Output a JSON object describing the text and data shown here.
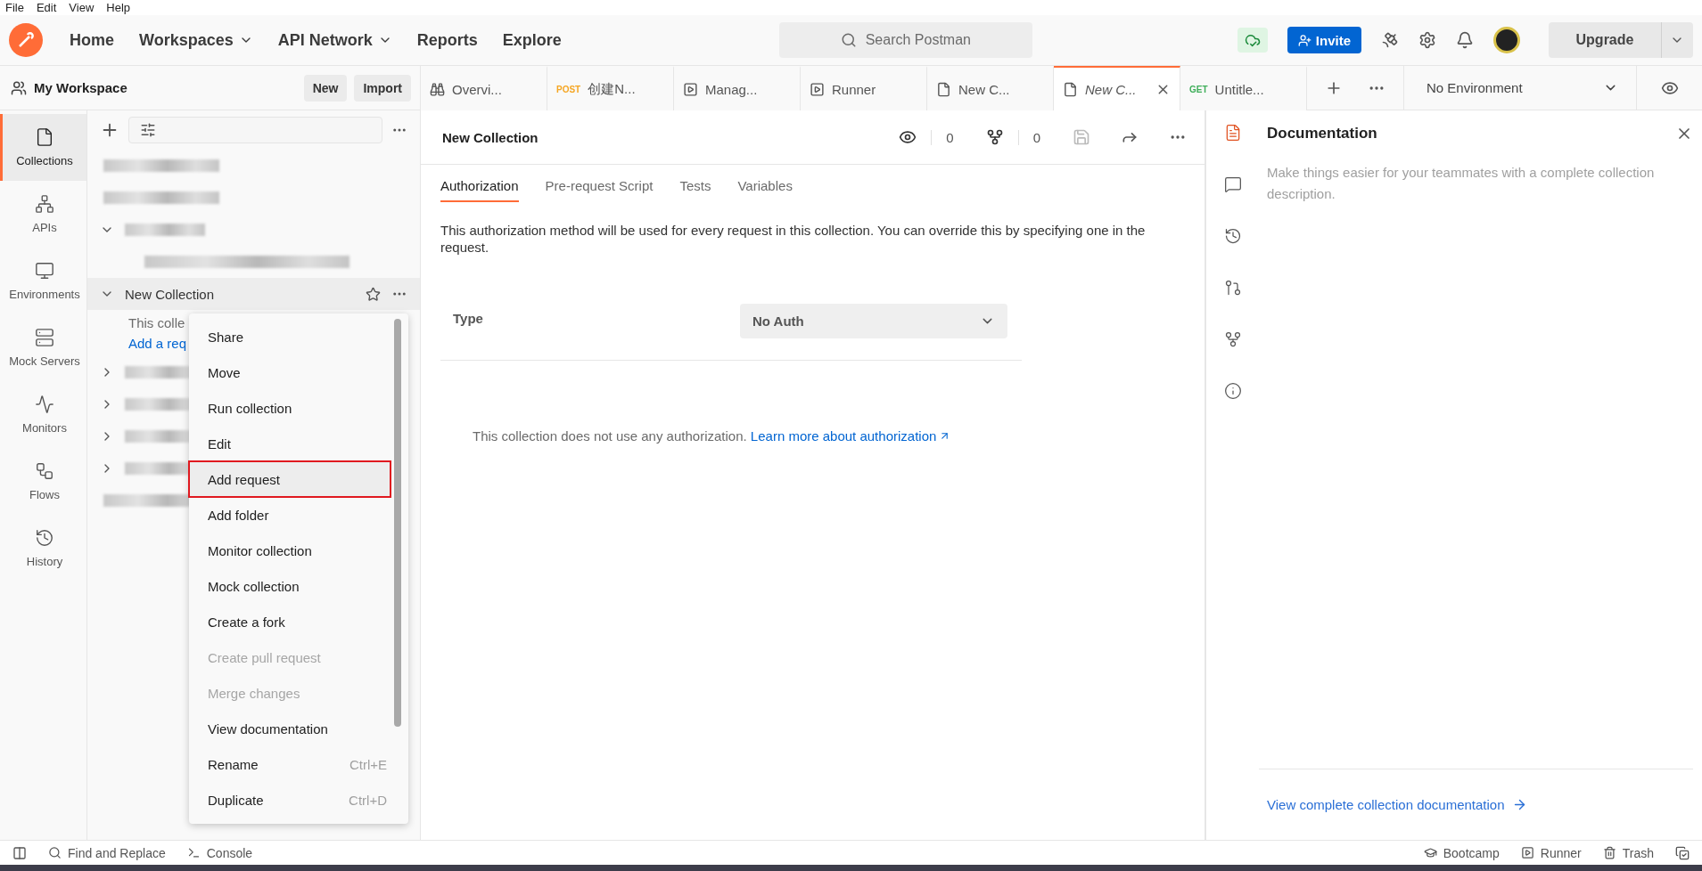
{
  "menubar": [
    "File",
    "Edit",
    "View",
    "Help"
  ],
  "header": {
    "nav": [
      {
        "label": "Home",
        "dropdown": false
      },
      {
        "label": "Workspaces",
        "dropdown": true
      },
      {
        "label": "API Network",
        "dropdown": true
      },
      {
        "label": "Reports",
        "dropdown": false
      },
      {
        "label": "Explore",
        "dropdown": false
      }
    ],
    "search": {
      "placeholder": "Search Postman"
    },
    "invite": "Invite",
    "upgrade": "Upgrade"
  },
  "workspace": {
    "title": "My Workspace",
    "buttons": [
      "New",
      "Import"
    ]
  },
  "tabs": [
    {
      "label": "Overvi...",
      "kind": "binoculars",
      "selected": false
    },
    {
      "label": "创建N...",
      "method": "POST",
      "color": "#f5a623",
      "selected": false
    },
    {
      "label": "Manag...",
      "kind": "play",
      "selected": false
    },
    {
      "label": "Runner",
      "kind": "play",
      "selected": false
    },
    {
      "label": "New C...",
      "kind": "doc",
      "selected": false
    },
    {
      "label": "New C...",
      "kind": "doc",
      "selected": true
    },
    {
      "label": "Untitle...",
      "method": "GET",
      "color": "#3fae5a",
      "selected": false
    }
  ],
  "environment": "No Environment",
  "leftnav": [
    {
      "label": "Collections",
      "selected": true
    },
    {
      "label": "APIs",
      "selected": false
    },
    {
      "label": "Environments",
      "selected": false
    },
    {
      "label": "Mock Servers",
      "selected": false
    },
    {
      "label": "Monitors",
      "selected": false
    },
    {
      "label": "Flows",
      "selected": false
    },
    {
      "label": "History",
      "selected": false
    }
  ],
  "collections": [
    {
      "kind": "blurred"
    },
    {
      "kind": "blurred"
    },
    {
      "kind": "blurred-group",
      "expanded": true
    },
    {
      "kind": "blurred-request"
    },
    {
      "kind": "collection",
      "label": "New Collection",
      "expanded": true,
      "description": "This colle",
      "link": "Add a req"
    },
    {
      "kind": "blurred-group",
      "expanded": false
    },
    {
      "kind": "blurred-group",
      "expanded": false
    },
    {
      "kind": "blurred-group",
      "expanded": false
    },
    {
      "kind": "blurred-group",
      "expanded": false
    },
    {
      "kind": "blurred"
    }
  ],
  "context_menu": [
    {
      "label": "Share",
      "disabled": false,
      "selected": false
    },
    {
      "label": "Move",
      "disabled": false,
      "selected": false
    },
    {
      "label": "Run collection",
      "disabled": false,
      "selected": false
    },
    {
      "label": "Edit",
      "disabled": false,
      "selected": false
    },
    {
      "label": "Add request",
      "disabled": false,
      "selected": true
    },
    {
      "label": "Add folder",
      "disabled": false,
      "selected": false
    },
    {
      "label": "Monitor collection",
      "disabled": false,
      "selected": false
    },
    {
      "label": "Mock collection",
      "disabled": false,
      "selected": false
    },
    {
      "label": "Create a fork",
      "disabled": false,
      "selected": false
    },
    {
      "label": "Create pull request",
      "disabled": true,
      "selected": false
    },
    {
      "label": "Merge changes",
      "disabled": true,
      "selected": false
    },
    {
      "label": "View documentation",
      "disabled": false,
      "selected": false
    },
    {
      "label": "Rename",
      "shortcut": "Ctrl+E",
      "disabled": false,
      "selected": false
    },
    {
      "label": "Duplicate",
      "shortcut": "Ctrl+D",
      "disabled": false,
      "selected": false
    }
  ],
  "main": {
    "title": "New Collection",
    "watchers": "0",
    "forks": "0",
    "subtabs": [
      {
        "label": "Authorization",
        "selected": true
      },
      {
        "label": "Pre-request Script",
        "selected": false
      },
      {
        "label": "Tests",
        "selected": false
      },
      {
        "label": "Variables",
        "selected": false
      }
    ],
    "description": "This authorization method will be used for every request in this collection. You can override this by specifying one in the request.",
    "type_label": "Type",
    "type_value": "No Auth",
    "note": "This collection does not use any authorization.",
    "note_link": "Learn more about authorization"
  },
  "right_panel": {
    "icons": [
      {
        "selected": true
      },
      {
        "selected": false
      },
      {
        "selected": false
      },
      {
        "selected": false
      },
      {
        "selected": false
      },
      {
        "selected": false
      }
    ],
    "title": "Documentation",
    "text": "Make things easier for your teammates with a complete collection description.",
    "link": "View complete collection documentation"
  },
  "status_bar": {
    "left": [
      "Find and Replace",
      "Console"
    ],
    "right": [
      "Bootcamp",
      "Runner",
      "Trash"
    ]
  }
}
